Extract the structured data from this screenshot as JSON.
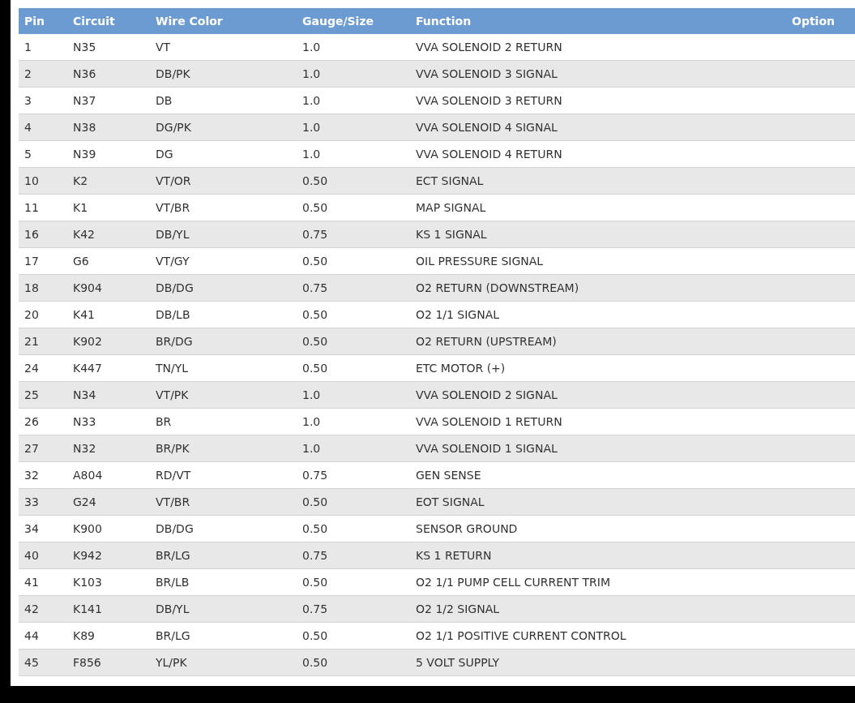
{
  "table": {
    "columns": [
      "Pin",
      "Circuit",
      "Wire Color",
      "Gauge/Size",
      "Function",
      "Option"
    ],
    "rows": [
      [
        "1",
        "N35",
        "VT",
        "1.0",
        "VVA SOLENOID 2 RETURN"
      ],
      [
        "2",
        "N36",
        "DB/PK",
        "1.0",
        "VVA SOLENOID 3 SIGNAL"
      ],
      [
        "3",
        "N37",
        "DB",
        "1.0",
        "VVA SOLENOID 3 RETURN"
      ],
      [
        "4",
        "N38",
        "DG/PK",
        "1.0",
        "VVA SOLENOID 4 SIGNAL"
      ],
      [
        "5",
        "N39",
        "DG",
        "1.0",
        "VVA SOLENOID 4 RETURN"
      ],
      [
        "10",
        "K2",
        "VT/OR",
        "0.50",
        "ECT SIGNAL"
      ],
      [
        "11",
        "K1",
        "VT/BR",
        "0.50",
        "MAP SIGNAL"
      ],
      [
        "16",
        "K42",
        "DB/YL",
        "0.75",
        "KS 1 SIGNAL"
      ],
      [
        "17",
        "G6",
        "VT/GY",
        "0.50",
        "OIL PRESSURE SIGNAL"
      ],
      [
        "18",
        "K904",
        "DB/DG",
        "0.75",
        "O2 RETURN (DOWNSTREAM)"
      ],
      [
        "20",
        "K41",
        "DB/LB",
        "0.50",
        "O2 1/1 SIGNAL"
      ],
      [
        "21",
        "K902",
        "BR/DG",
        "0.50",
        "O2 RETURN (UPSTREAM)"
      ],
      [
        "24",
        "K447",
        "TN/YL",
        "0.50",
        "ETC MOTOR (+)"
      ],
      [
        "25",
        "N34",
        "VT/PK",
        "1.0",
        "VVA SOLENOID 2 SIGNAL"
      ],
      [
        "26",
        "N33",
        "BR",
        "1.0",
        "VVA SOLENOID 1 RETURN"
      ],
      [
        "27",
        "N32",
        "BR/PK",
        "1.0",
        "VVA SOLENOID 1 SIGNAL"
      ],
      [
        "32",
        "A804",
        "RD/VT",
        "0.75",
        "GEN SENSE"
      ],
      [
        "33",
        "G24",
        "VT/BR",
        "0.50",
        "EOT SIGNAL"
      ],
      [
        "34",
        "K900",
        "DB/DG",
        "0.50",
        "SENSOR GROUND"
      ],
      [
        "40",
        "K942",
        "BR/LG",
        "0.75",
        "KS 1 RETURN"
      ],
      [
        "41",
        "K103",
        "BR/LB",
        "0.50",
        "O2 1/1 PUMP CELL CURRENT TRIM"
      ],
      [
        "42",
        "K141",
        "DB/YL",
        "0.75",
        "O2 1/2 SIGNAL"
      ],
      [
        "44",
        "K89",
        "BR/LG",
        "0.50",
        "O2 1/1 POSITIVE CURRENT CONTROL"
      ],
      [
        "45",
        "F856",
        "YL/PK",
        "0.50",
        "5 VOLT SUPPLY"
      ]
    ]
  }
}
